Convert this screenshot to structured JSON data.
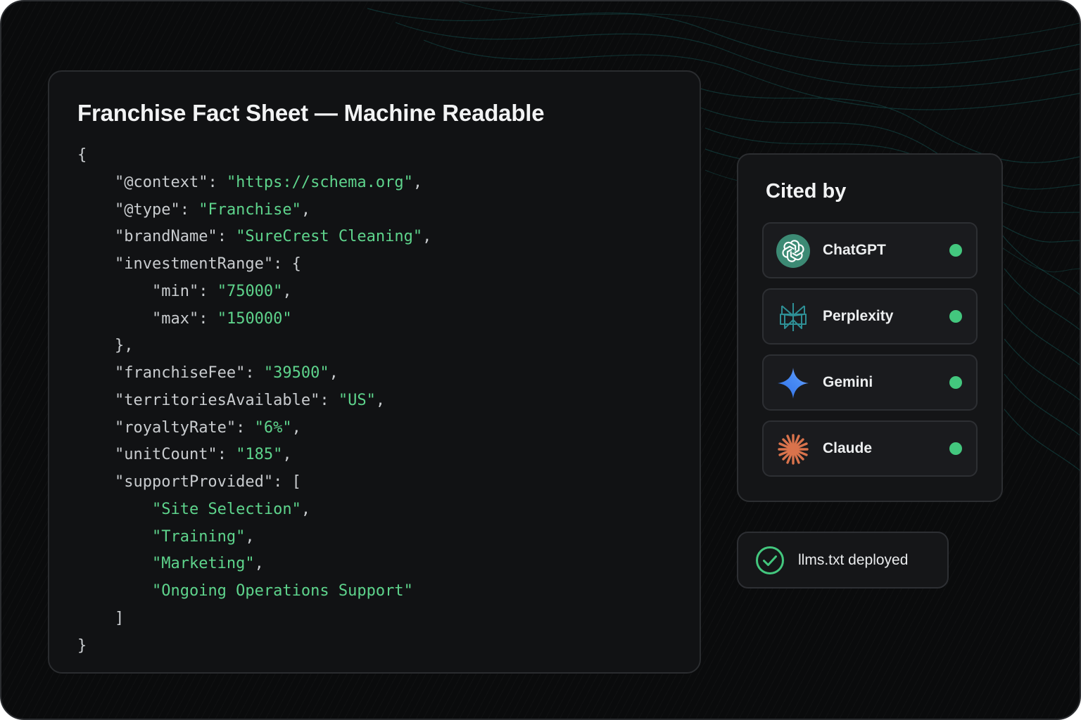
{
  "colors": {
    "frame_bg": "#0a0b0c",
    "card_bg": "#111214",
    "string_green": "#5ed48c",
    "key_gray": "#c9cccf",
    "status_green": "#43c77e",
    "accent_teal": "#1f6b66"
  },
  "fact_sheet": {
    "title": "Franchise Fact Sheet — Machine Readable",
    "lines": [
      {
        "indent": "",
        "key": "",
        "value": "",
        "punct": "{"
      },
      {
        "indent": "    ",
        "key": "\"@context\"",
        "sep": ": ",
        "value": "\"https://schema.org\"",
        "punct": ","
      },
      {
        "indent": "    ",
        "key": "\"@type\"",
        "sep": ": ",
        "value": "\"Franchise\"",
        "punct": ","
      },
      {
        "indent": "    ",
        "key": "\"brandName\"",
        "sep": ": ",
        "value": "\"SureCrest Cleaning\"",
        "punct": ","
      },
      {
        "indent": "    ",
        "key": "\"investmentRange\"",
        "sep": ": ",
        "value": "",
        "punct": "{"
      },
      {
        "indent": "        ",
        "key": "\"min\"",
        "sep": ": ",
        "value": "\"75000\"",
        "punct": ","
      },
      {
        "indent": "        ",
        "key": "\"max\"",
        "sep": ": ",
        "value": "\"150000\"",
        "punct": ""
      },
      {
        "indent": "    ",
        "key": "",
        "sep": "",
        "value": "",
        "punct": "},"
      },
      {
        "indent": "    ",
        "key": "\"franchiseFee\"",
        "sep": ": ",
        "value": "\"39500\"",
        "punct": ","
      },
      {
        "indent": "    ",
        "key": "\"territoriesAvailable\"",
        "sep": ": ",
        "value": "\"US\"",
        "punct": ","
      },
      {
        "indent": "    ",
        "key": "\"royaltyRate\"",
        "sep": ": ",
        "value": "\"6%\"",
        "punct": ","
      },
      {
        "indent": "    ",
        "key": "\"unitCount\"",
        "sep": ": ",
        "value": "\"185\"",
        "punct": ","
      },
      {
        "indent": "    ",
        "key": "\"supportProvided\"",
        "sep": ": ",
        "value": "",
        "punct": "["
      },
      {
        "indent": "        ",
        "key": "",
        "sep": "",
        "value": "\"Site Selection\"",
        "punct": ","
      },
      {
        "indent": "        ",
        "key": "",
        "sep": "",
        "value": "\"Training\"",
        "punct": ","
      },
      {
        "indent": "        ",
        "key": "",
        "sep": "",
        "value": "\"Marketing\"",
        "punct": ","
      },
      {
        "indent": "        ",
        "key": "",
        "sep": "",
        "value": "\"Ongoing Operations Support\"",
        "punct": ""
      },
      {
        "indent": "    ",
        "key": "",
        "sep": "",
        "value": "",
        "punct": "]"
      },
      {
        "indent": "",
        "key": "",
        "sep": "",
        "value": "",
        "punct": "}"
      }
    ]
  },
  "cited_by": {
    "title": "Cited by",
    "providers": [
      {
        "name": "ChatGPT",
        "icon": "chatgpt-icon",
        "status": "active"
      },
      {
        "name": "Perplexity",
        "icon": "perplexity-icon",
        "status": "active"
      },
      {
        "name": "Gemini",
        "icon": "gemini-icon",
        "status": "active"
      },
      {
        "name": "Claude",
        "icon": "claude-icon",
        "status": "active"
      }
    ]
  },
  "deploy_status": {
    "label": "llms.txt deployed",
    "icon": "check-circle-icon"
  }
}
